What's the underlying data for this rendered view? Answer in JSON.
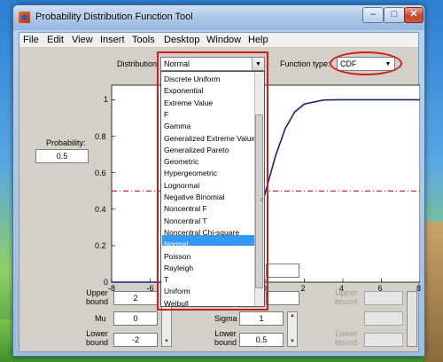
{
  "window": {
    "title": "Probability Distribution Function Tool",
    "controls": {
      "minimize": "–",
      "maximize": "□",
      "close": "✕"
    }
  },
  "menu": [
    "File",
    "Edit",
    "View",
    "Insert",
    "Tools",
    "Desktop",
    "Window",
    "Help"
  ],
  "distribution": {
    "label": "Distribution:",
    "value": "Normal",
    "options": [
      "Discrete Uniform",
      "Exponential",
      "Extreme Value",
      "F",
      "Gamma",
      "Generalized Extreme Value",
      "Generalized Pareto",
      "Geometric",
      "Hypergeometric",
      "Lognormal",
      "Negative Binomial",
      "Noncentral F",
      "Noncentral T",
      "Noncentral Chi-square",
      "Normal",
      "Poisson",
      "Rayleigh",
      "T",
      "Uniform",
      "Weibull"
    ],
    "selected_option": "Normal"
  },
  "function_type": {
    "label": "Function type:",
    "value": "CDF"
  },
  "probability": {
    "label": "Probability:",
    "value": "0.5"
  },
  "params": {
    "mu": {
      "upper_label": "Upper\nbound",
      "upper_value": "2",
      "label": "Mu",
      "value": "0",
      "lower_label": "Lower\nbound",
      "lower_value": "-2"
    },
    "sigma": {
      "label": "Sigma",
      "value": "1",
      "lower_label": "Lower\nbound",
      "lower_value": "0.5"
    },
    "third": {
      "upper_label": "Upper\nbound",
      "lower_label": "Lower\nbound"
    }
  },
  "chart_data": {
    "type": "line",
    "title": "",
    "xlabel": "",
    "ylabel": "",
    "xlim": [
      -8,
      8
    ],
    "ylim": [
      0,
      1.08
    ],
    "xticks": [
      -8,
      -6,
      -4,
      -2,
      0,
      2,
      4,
      6,
      8
    ],
    "yticks": [
      0,
      0.2,
      0.4,
      0.6,
      0.8,
      1
    ],
    "visible_xtick_labels": [
      "-8",
      "-6",
      "0",
      "2",
      "4",
      "6",
      "8"
    ],
    "visible_ytick_labels": [
      "0",
      "0.2",
      "0.4",
      "0.6",
      "0.8",
      "1"
    ],
    "series": [
      {
        "x": [
          -8,
          -4,
          -3,
          -2,
          -1.5,
          -1,
          -0.5,
          0,
          0.5,
          1,
          1.5,
          2,
          3,
          4,
          8
        ],
        "values": [
          0,
          0,
          0.001,
          0.023,
          0.067,
          0.159,
          0.309,
          0.5,
          0.691,
          0.841,
          0.933,
          0.977,
          0.999,
          1,
          1
        ],
        "color": "#1a237e"
      }
    ],
    "reference_line": {
      "y": 0.5,
      "style": "dash-dot",
      "color": "#c00000"
    }
  },
  "colors": {
    "highlight": "#3399ff",
    "annotation_red": "#cc2020",
    "curve": "#1a237e"
  }
}
